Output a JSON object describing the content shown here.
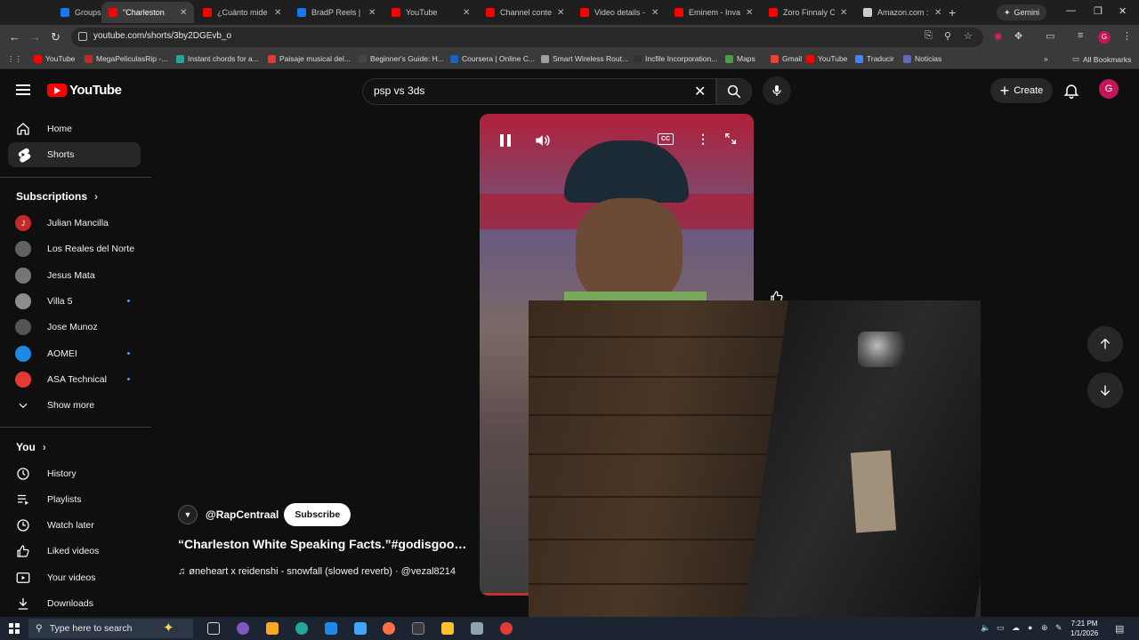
{
  "browser": {
    "tabs": [
      {
        "title": "Groups | Facebook",
        "favicon_color": "#1877f2",
        "active": false
      },
      {
        "title": "\"Charleston",
        "favicon_color": "#ff0000",
        "active": true
      },
      {
        "title": "¿Cuánto mide c",
        "favicon_color": "#ff0000",
        "active": false
      },
      {
        "title": "BradP Reels | Fa",
        "favicon_color": "#1877f2",
        "active": false
      },
      {
        "title": "YouTube",
        "favicon_color": "#ff0000",
        "active": false
      },
      {
        "title": "Channel conten",
        "favicon_color": "#ff0000",
        "active": false
      },
      {
        "title": "Video details - Y",
        "favicon_color": "#ff0000",
        "active": false
      },
      {
        "title": "Eminem - Invas",
        "favicon_color": "#ff0000",
        "active": false
      },
      {
        "title": "Zoro Finnaly Op",
        "favicon_color": "#ff0000",
        "active": false
      },
      {
        "title": "Amazon.com : b",
        "favicon_color": "#cccccc",
        "active": false
      }
    ],
    "gemini_label": "Gemini",
    "url": "youtube.com/shorts/3by2DGEvb_o",
    "bookmarks": [
      {
        "label": "YouTube",
        "color": "#ff0000"
      },
      {
        "label": "MegaPeliculasRip -...",
        "color": "#c62828"
      },
      {
        "label": "Instant chords for a...",
        "color": "#26a69a"
      },
      {
        "label": "Paisaje musical del...",
        "color": "#e53935"
      },
      {
        "label": "Beginner's Guide: H...",
        "color": "#444444"
      },
      {
        "label": "Coursera | Online C...",
        "color": "#1565c0"
      },
      {
        "label": "Smart Wireless Rout...",
        "color": "#9e9e9e"
      },
      {
        "label": "Incfile Incorporation...",
        "color": "#333333"
      },
      {
        "label": "Maps",
        "color": "#43a047"
      },
      {
        "label": "Gmail",
        "color": "#ea4335"
      },
      {
        "label": "YouTube",
        "color": "#ff0000"
      },
      {
        "label": "Traducir",
        "color": "#4285f4"
      },
      {
        "label": "Noticias",
        "color": "#5c6bc0"
      }
    ],
    "all_bookmarks": "All Bookmarks"
  },
  "header": {
    "logo": "YouTube",
    "search_value": "psp vs 3ds",
    "create_label": "Create",
    "avatar_letter": "G"
  },
  "sidebar": {
    "main": [
      {
        "label": "Home",
        "icon": "home-icon"
      },
      {
        "label": "Shorts",
        "icon": "shorts-icon"
      }
    ],
    "subscriptions_heading": "Subscriptions",
    "subscriptions": [
      {
        "name": "Julian Mancilla",
        "avatar_color": "#c62828",
        "initial": "J",
        "new": false
      },
      {
        "name": "Los Reales del Norte",
        "avatar_color": "#616161",
        "initial": "",
        "new": false
      },
      {
        "name": "Jesus Mata",
        "avatar_color": "#757575",
        "initial": "",
        "new": false
      },
      {
        "name": "Villa 5",
        "avatar_color": "#8d8d8d",
        "initial": "",
        "new": true
      },
      {
        "name": "Jose Munoz",
        "avatar_color": "#555555",
        "initial": "",
        "new": false
      },
      {
        "name": "AOMEI",
        "avatar_color": "#1e88e5",
        "initial": "",
        "new": true
      },
      {
        "name": "ASA Technical",
        "avatar_color": "#e53935",
        "initial": "",
        "new": true
      }
    ],
    "show_more": "Show more",
    "you_heading": "You",
    "you_items": [
      {
        "label": "History",
        "icon": "history-icon"
      },
      {
        "label": "Playlists",
        "icon": "playlists-icon"
      },
      {
        "label": "Watch later",
        "icon": "watch-later-icon"
      },
      {
        "label": "Liked videos",
        "icon": "liked-icon"
      },
      {
        "label": "Your videos",
        "icon": "your-videos-icon"
      },
      {
        "label": "Downloads",
        "icon": "downloads-icon"
      }
    ]
  },
  "short": {
    "channel": "@RapCentraal",
    "subscribe_label": "Subscribe",
    "title": "“Charleston White Speaking Facts.”#godisgood ...",
    "music": "øneheart x reidenshi - snowfall (slowed reverb) · @vezal8214",
    "cc_label": "CC"
  },
  "taskbar": {
    "search_placeholder": "Type here to search",
    "time": "7:21 PM",
    "date": "1/1/2026"
  }
}
